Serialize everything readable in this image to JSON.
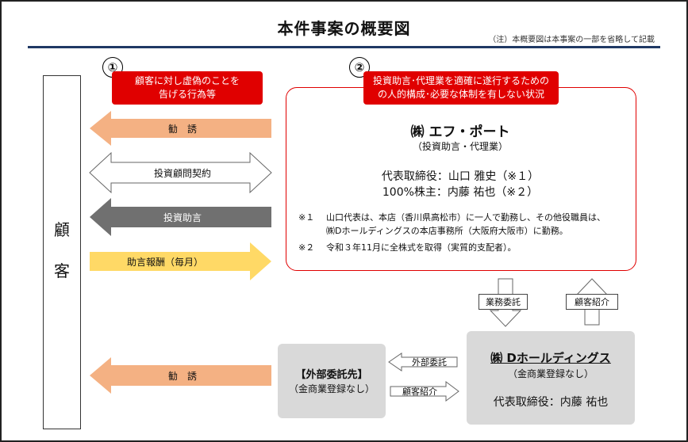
{
  "header": {
    "title": "本件事案の概要図",
    "note": "（注）本概要図は本事案の一部を省略して記載"
  },
  "customer": {
    "label_1": "顧",
    "label_2": "客"
  },
  "issue1": {
    "number": "①",
    "line1": "顧客に対し虚偽のことを",
    "line2": "告げる行為等"
  },
  "issue2": {
    "number": "②",
    "line1": "投資助言･代理業を適確に遂行するための",
    "line2": "の人的構成･必要な体制を有しない状況"
  },
  "arrows": {
    "solicit": "勧　誘",
    "contract": "投資顧問契約",
    "advice": "投資助言",
    "fee": "助言報酬（毎月）",
    "solicit2": "勧　誘"
  },
  "firm": {
    "name": "㈱ エフ・ポート",
    "type": "（投資助言・代理業）",
    "ceo": "代表取締役：山口 雅史（※１）",
    "owner": "100%株主：内藤 祐也（※２）",
    "note1_mark": "※１",
    "note1_line1": "山口代表は、本店（香川県高松市）に一人で勤務し、その他役職員は、",
    "note1_line2": "㈱Dホールディングスの本店事務所（大阪府大阪市）に勤務。",
    "note2_mark": "※２",
    "note2_line1": "令和３年11月に全株式を取得（実質的支配者）。"
  },
  "holdings": {
    "name": "㈱ Dホールディングス",
    "status": "（金商業登録なし）",
    "ceo": "代表取締役：内藤 祐也"
  },
  "outsource": {
    "name": "【外部委託先】",
    "status": "（金商業登録なし）"
  },
  "links": {
    "business_delegation": "業務委託",
    "customer_referral_up": "顧客紹介",
    "external_delegation": "外部委託",
    "customer_referral_right": "顧客紹介"
  },
  "colors": {
    "solicit_arrow": "#f4b183",
    "advice_arrow": "#707070",
    "fee_arrow": "#ffd966",
    "red": "#e00000",
    "title_bar": "#1f3864",
    "gray_box": "#d9d9d9"
  }
}
